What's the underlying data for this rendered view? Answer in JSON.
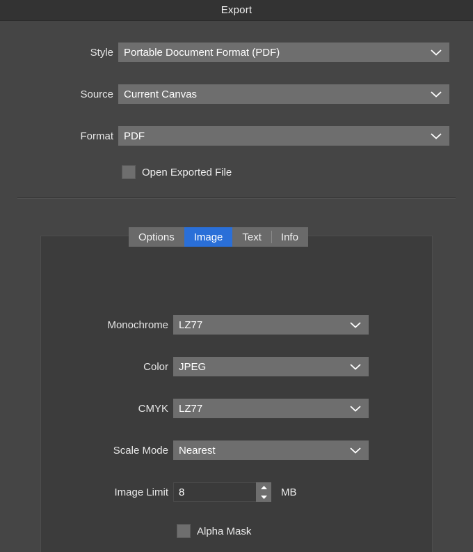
{
  "window": {
    "title": "Export"
  },
  "top_form": {
    "rows": [
      {
        "label": "Style",
        "value": "Portable Document Format (PDF)",
        "icon": "chevron-down-icon"
      },
      {
        "label": "Source",
        "value": "Current Canvas",
        "icon": "chevron-down-icon"
      },
      {
        "label": "Format",
        "value": "PDF",
        "icon": "chevron-down-icon"
      }
    ],
    "open_exported_file": {
      "label": "Open Exported File",
      "checked": false
    }
  },
  "tabs": {
    "items": [
      {
        "label": "Options",
        "selected": false
      },
      {
        "label": "Image",
        "selected": true
      },
      {
        "label": "Text",
        "selected": false
      },
      {
        "label": "Info",
        "selected": false
      }
    ],
    "selected": "Image"
  },
  "image_panel": {
    "rows": [
      {
        "label": "Monochrome",
        "value": "LZ77",
        "icon": "chevron-down-icon"
      },
      {
        "label": "Color",
        "value": "JPEG",
        "icon": "chevron-down-icon"
      },
      {
        "label": "CMYK",
        "value": "LZ77",
        "icon": "chevron-down-icon"
      },
      {
        "label": "Scale Mode",
        "value": "Nearest",
        "icon": "chevron-down-icon"
      }
    ],
    "image_limit": {
      "label": "Image Limit",
      "value": "8",
      "unit": "MB",
      "increment_icon": "triangle-up-icon",
      "decrement_icon": "triangle-down-icon"
    },
    "alpha_mask": {
      "label": "Alpha Mask",
      "checked": false
    }
  },
  "colors": {
    "titlebar_bg": "#333333",
    "window_bg": "#454545",
    "panel_bg": "#3c3c3c",
    "control_bg": "#6e6e6e",
    "accent_selected_tab": "#2a6fd8",
    "text": "#ececec",
    "field_bg": "#3a3a3a"
  }
}
